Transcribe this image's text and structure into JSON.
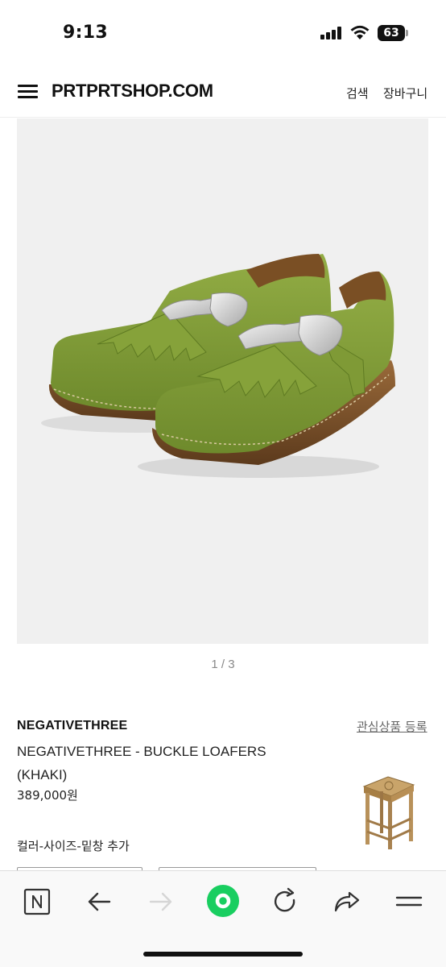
{
  "status_bar": {
    "time": "9:13",
    "battery": "63"
  },
  "header": {
    "logo": "PRTPRTSHOP.COM",
    "search": "검색",
    "cart": "장바구니"
  },
  "gallery": {
    "pager": "1 / 3"
  },
  "product": {
    "brand": "NEGATIVETHREE",
    "wishlist": "관심상품 등록",
    "title": "NEGATIVETHREE - BUCKLE LOAFERS (KHAKI)",
    "price": "389,000원",
    "option_label": "컬러-사이즈-밑창 추가"
  },
  "toolbar": {
    "items": [
      "naver-icon",
      "back-arrow-icon",
      "forward-arrow-icon",
      "green-home-icon",
      "refresh-icon",
      "share-icon",
      "menu-icon"
    ]
  },
  "colors": {
    "accent_green": "#19ce60",
    "shoe_khaki": "#7f9a36",
    "background": "#f0f0f0"
  }
}
